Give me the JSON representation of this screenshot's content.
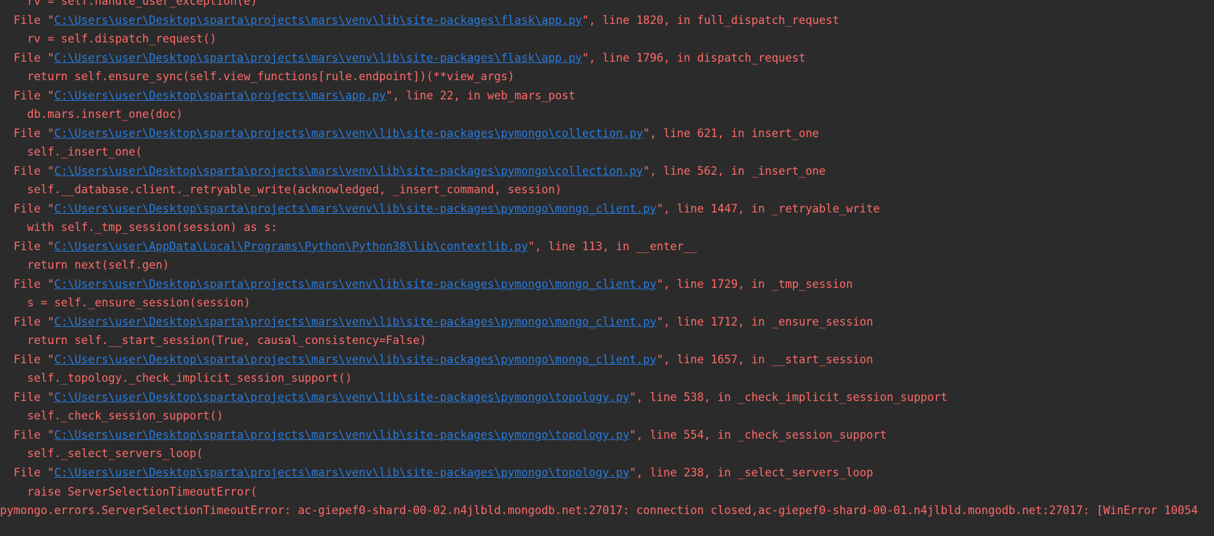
{
  "console": {
    "lines": [
      {
        "kind": "code",
        "text": "    rv = self.handle_user_exception(e)"
      },
      {
        "kind": "frame",
        "pre": "  File \"",
        "path": "C:\\Users\\user\\Desktop\\sparta\\projects\\mars\\venv\\lib\\site-packages\\flask\\app.py",
        "post": "\", line 1820, in full_dispatch_request"
      },
      {
        "kind": "code",
        "text": "    rv = self.dispatch_request()"
      },
      {
        "kind": "frame",
        "pre": "  File \"",
        "path": "C:\\Users\\user\\Desktop\\sparta\\projects\\mars\\venv\\lib\\site-packages\\flask\\app.py",
        "post": "\", line 1796, in dispatch_request"
      },
      {
        "kind": "code",
        "text": "    return self.ensure_sync(self.view_functions[rule.endpoint])(**view_args)"
      },
      {
        "kind": "frame",
        "pre": "  File \"",
        "path": "C:\\Users\\user\\Desktop\\sparta\\projects\\mars\\app.py",
        "post": "\", line 22, in web_mars_post"
      },
      {
        "kind": "code",
        "text": "    db.mars.insert_one(doc)"
      },
      {
        "kind": "frame",
        "pre": "  File \"",
        "path": "C:\\Users\\user\\Desktop\\sparta\\projects\\mars\\venv\\lib\\site-packages\\pymongo\\collection.py",
        "post": "\", line 621, in insert_one"
      },
      {
        "kind": "code",
        "text": "    self._insert_one("
      },
      {
        "kind": "frame",
        "pre": "  File \"",
        "path": "C:\\Users\\user\\Desktop\\sparta\\projects\\mars\\venv\\lib\\site-packages\\pymongo\\collection.py",
        "post": "\", line 562, in _insert_one"
      },
      {
        "kind": "code",
        "text": "    self.__database.client._retryable_write(acknowledged, _insert_command, session)"
      },
      {
        "kind": "frame",
        "pre": "  File \"",
        "path": "C:\\Users\\user\\Desktop\\sparta\\projects\\mars\\venv\\lib\\site-packages\\pymongo\\mongo_client.py",
        "post": "\", line 1447, in _retryable_write"
      },
      {
        "kind": "code",
        "text": "    with self._tmp_session(session) as s:"
      },
      {
        "kind": "frame",
        "pre": "  File \"",
        "path": "C:\\Users\\user\\AppData\\Local\\Programs\\Python\\Python38\\lib\\contextlib.py",
        "post": "\", line 113, in __enter__"
      },
      {
        "kind": "code",
        "text": "    return next(self.gen)"
      },
      {
        "kind": "frame",
        "pre": "  File \"",
        "path": "C:\\Users\\user\\Desktop\\sparta\\projects\\mars\\venv\\lib\\site-packages\\pymongo\\mongo_client.py",
        "post": "\", line 1729, in _tmp_session"
      },
      {
        "kind": "code",
        "text": "    s = self._ensure_session(session)"
      },
      {
        "kind": "frame",
        "pre": "  File \"",
        "path": "C:\\Users\\user\\Desktop\\sparta\\projects\\mars\\venv\\lib\\site-packages\\pymongo\\mongo_client.py",
        "post": "\", line 1712, in _ensure_session"
      },
      {
        "kind": "code",
        "text": "    return self.__start_session(True, causal_consistency=False)"
      },
      {
        "kind": "frame",
        "pre": "  File \"",
        "path": "C:\\Users\\user\\Desktop\\sparta\\projects\\mars\\venv\\lib\\site-packages\\pymongo\\mongo_client.py",
        "post": "\", line 1657, in __start_session"
      },
      {
        "kind": "code",
        "text": "    self._topology._check_implicit_session_support()"
      },
      {
        "kind": "frame",
        "pre": "  File \"",
        "path": "C:\\Users\\user\\Desktop\\sparta\\projects\\mars\\venv\\lib\\site-packages\\pymongo\\topology.py",
        "post": "\", line 538, in _check_implicit_session_support"
      },
      {
        "kind": "code",
        "text": "    self._check_session_support()"
      },
      {
        "kind": "frame",
        "pre": "  File \"",
        "path": "C:\\Users\\user\\Desktop\\sparta\\projects\\mars\\venv\\lib\\site-packages\\pymongo\\topology.py",
        "post": "\", line 554, in _check_session_support"
      },
      {
        "kind": "code",
        "text": "    self._select_servers_loop("
      },
      {
        "kind": "frame",
        "pre": "  File \"",
        "path": "C:\\Users\\user\\Desktop\\sparta\\projects\\mars\\venv\\lib\\site-packages\\pymongo\\topology.py",
        "post": "\", line 238, in _select_servers_loop"
      },
      {
        "kind": "code",
        "text": "    raise ServerSelectionTimeoutError("
      },
      {
        "kind": "code",
        "text": "pymongo.errors.ServerSelectionTimeoutError: ac-giepef0-shard-00-02.n4jlbld.mongodb.net:27017: connection closed,ac-giepef0-shard-00-01.n4jlbld.mongodb.net:27017: [WinError 10054"
      }
    ]
  },
  "colors": {
    "background": "#2b2b2b",
    "error_text": "#ff6b68",
    "link": "#287bde"
  }
}
